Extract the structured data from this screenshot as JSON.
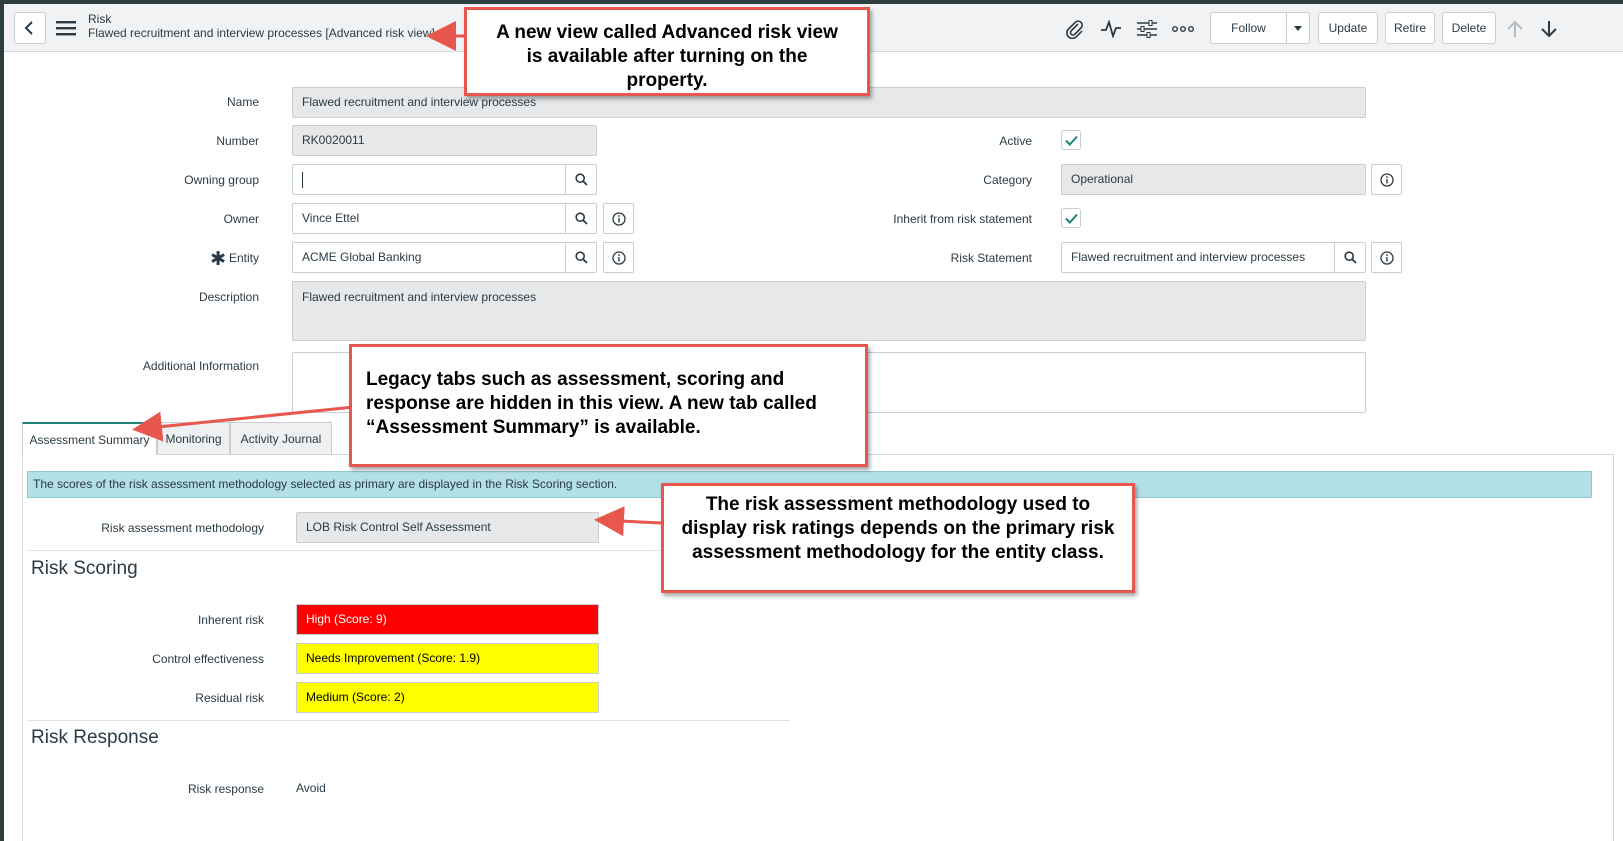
{
  "header": {
    "table_name": "Risk",
    "record_display": "Flawed recruitment and interview processes [Advanced risk view]",
    "follow_label": "Follow",
    "update_label": "Update",
    "retire_label": "Retire",
    "delete_label": "Delete"
  },
  "form": {
    "name_label": "Name",
    "name_value": "Flawed recruitment and interview processes",
    "number_label": "Number",
    "number_value": "RK0020011",
    "owning_group_label": "Owning group",
    "owning_group_value": "",
    "owner_label": "Owner",
    "owner_value": "Vince Ettel",
    "entity_label": "Entity",
    "entity_value": "ACME Global Banking",
    "description_label": "Description",
    "description_value": "Flawed recruitment and interview processes",
    "additional_info_label": "Additional Information",
    "additional_info_value": "",
    "active_label": "Active",
    "active_checked": true,
    "category_label": "Category",
    "category_value": "Operational",
    "inherit_label": "Inherit from risk statement",
    "inherit_checked": true,
    "risk_statement_label": "Risk Statement",
    "risk_statement_value": "Flawed recruitment and interview processes"
  },
  "tabs": [
    {
      "label": "Assessment Summary",
      "active": true
    },
    {
      "label": "Monitoring",
      "active": false
    },
    {
      "label": "Activity Journal",
      "active": false
    }
  ],
  "assessment_summary": {
    "banner": "The scores of the risk assessment methodology selected as primary are displayed in the Risk Scoring section.",
    "methodology_label": "Risk assessment methodology",
    "methodology_value": "LOB Risk Control Self Assessment",
    "scoring_title": "Risk Scoring",
    "inherent_label": "Inherent risk",
    "inherent_value": "High (Score: 9)",
    "inherent_color": "#ff0000",
    "control_label": "Control effectiveness",
    "control_value": "Needs Improvement (Score: 1.9)",
    "control_color": "#ffff00",
    "residual_label": "Residual risk",
    "residual_value": "Medium (Score: 2)",
    "residual_color": "#ffff00",
    "response_title": "Risk Response",
    "response_label": "Risk response",
    "response_value": "Avoid"
  },
  "annotations": {
    "view_note_line1": "A new view called Advanced risk view",
    "view_note_line2": "is available after turning on the",
    "view_note_line3": "property.",
    "tabs_note_line1": "Legacy tabs such as assessment, scoring and",
    "tabs_note_line2": "response are hidden in this view. A new tab called",
    "tabs_note_line3": "“Assessment Summary” is available.",
    "method_note_line1": "The risk assessment methodology used to",
    "method_note_line2": "display risk ratings depends on the primary risk",
    "method_note_line3": "assessment methodology for the entity class."
  },
  "colors": {
    "accent": "#1f8476",
    "callout_border": "#e8574e",
    "banner_bg": "#b3dfe6"
  }
}
